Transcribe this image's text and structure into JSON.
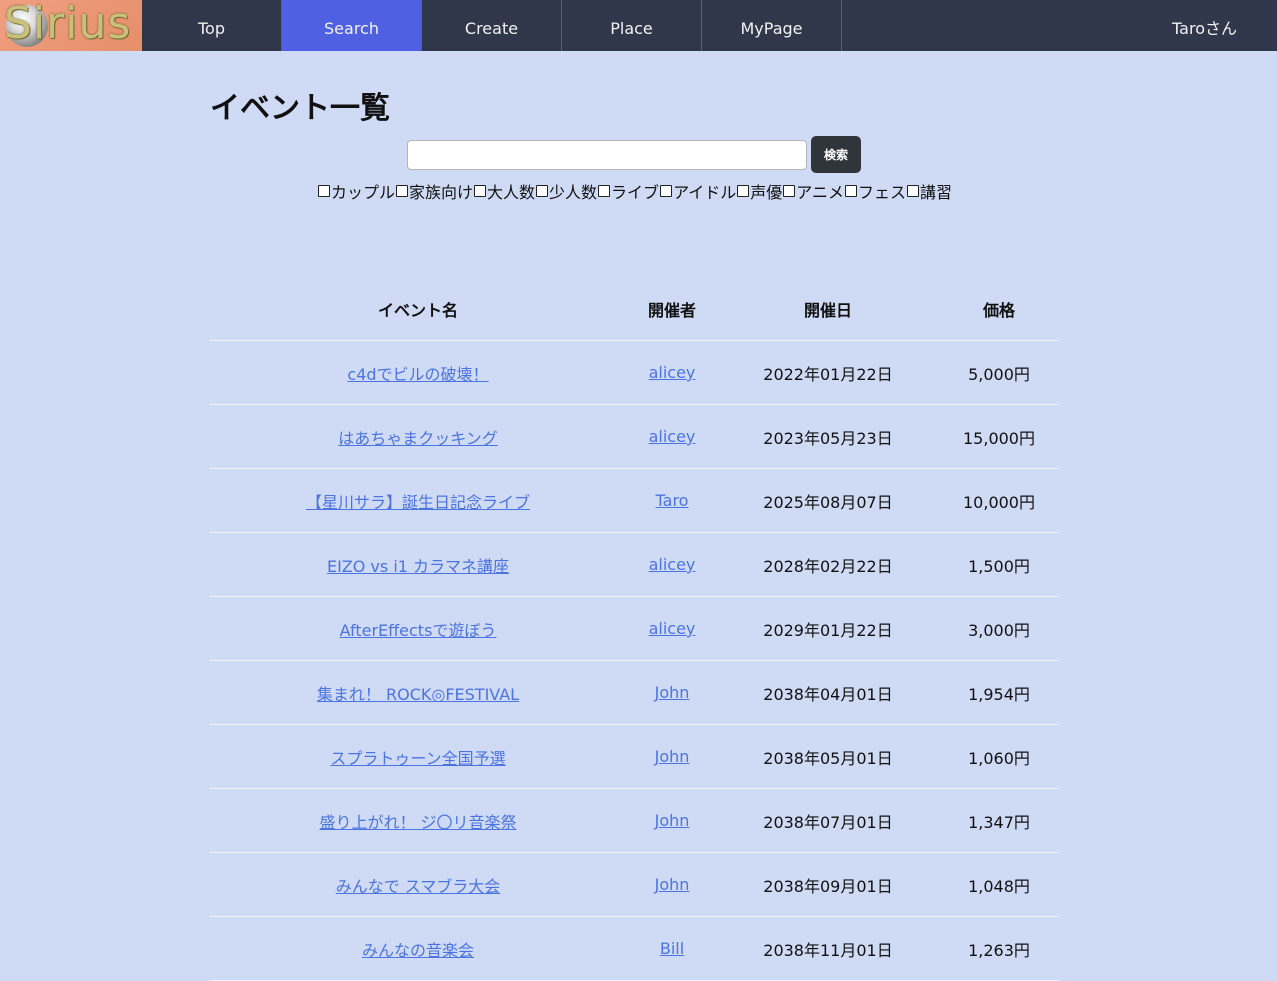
{
  "brand": {
    "logo_text": "Sirius"
  },
  "nav": {
    "items": [
      {
        "label": "Top"
      },
      {
        "label": "Search"
      },
      {
        "label": "Create"
      },
      {
        "label": "Place"
      },
      {
        "label": "MyPage"
      }
    ],
    "active": "Search",
    "user": "Taroさん"
  },
  "colors": {
    "nav_bg": "#30374a",
    "nav_active": "#4f60e3",
    "page_bg": "#cfdaf5",
    "link": "#4c74e0",
    "button_bg": "#30343b"
  },
  "page": {
    "title": "イベント一覧",
    "search": {
      "value": "",
      "placeholder": "",
      "button_label": "検索"
    },
    "filters": [
      {
        "label": "カップル",
        "checked": false
      },
      {
        "label": "家族向け",
        "checked": false
      },
      {
        "label": "大人数",
        "checked": false
      },
      {
        "label": "少人数",
        "checked": false
      },
      {
        "label": "ライブ",
        "checked": false
      },
      {
        "label": "アイドル",
        "checked": false
      },
      {
        "label": "声優",
        "checked": false
      },
      {
        "label": "アニメ",
        "checked": false
      },
      {
        "label": "フェス",
        "checked": false
      },
      {
        "label": "講習",
        "checked": false
      }
    ]
  },
  "table": {
    "headers": {
      "name": "イベント名",
      "organizer": "開催者",
      "date": "開催日",
      "price": "価格"
    },
    "rows": [
      {
        "name": "c4dでビルの破壊！",
        "organizer": "alicey",
        "date": "2022年01月22日",
        "price": "5,000円"
      },
      {
        "name": "はあちゃまクッキング",
        "organizer": "alicey",
        "date": "2023年05月23日",
        "price": "15,000円"
      },
      {
        "name": "【星川サラ】誕生日記念ライブ",
        "organizer": "Taro",
        "date": "2025年08月07日",
        "price": "10,000円"
      },
      {
        "name": "EIZO vs i1 カラマネ講座",
        "organizer": "alicey",
        "date": "2028年02月22日",
        "price": "1,500円"
      },
      {
        "name": "AfterEffectsで遊ぼう",
        "organizer": "alicey",
        "date": "2029年01月22日",
        "price": "3,000円"
      },
      {
        "name": "集まれ！ ROCK◎FESTIVAL",
        "organizer": "John",
        "date": "2038年04月01日",
        "price": "1,954円"
      },
      {
        "name": "スプラトゥーン全国予選",
        "organizer": "John",
        "date": "2038年05月01日",
        "price": "1,060円"
      },
      {
        "name": "盛り上がれ！ ジ〇リ音楽祭",
        "organizer": "John",
        "date": "2038年07月01日",
        "price": "1,347円"
      },
      {
        "name": "みんなで スマブラ大会",
        "organizer": "John",
        "date": "2038年09月01日",
        "price": "1,048円"
      },
      {
        "name": "みんなの音楽会",
        "organizer": "Bill",
        "date": "2038年11月01日",
        "price": "1,263円"
      }
    ]
  }
}
